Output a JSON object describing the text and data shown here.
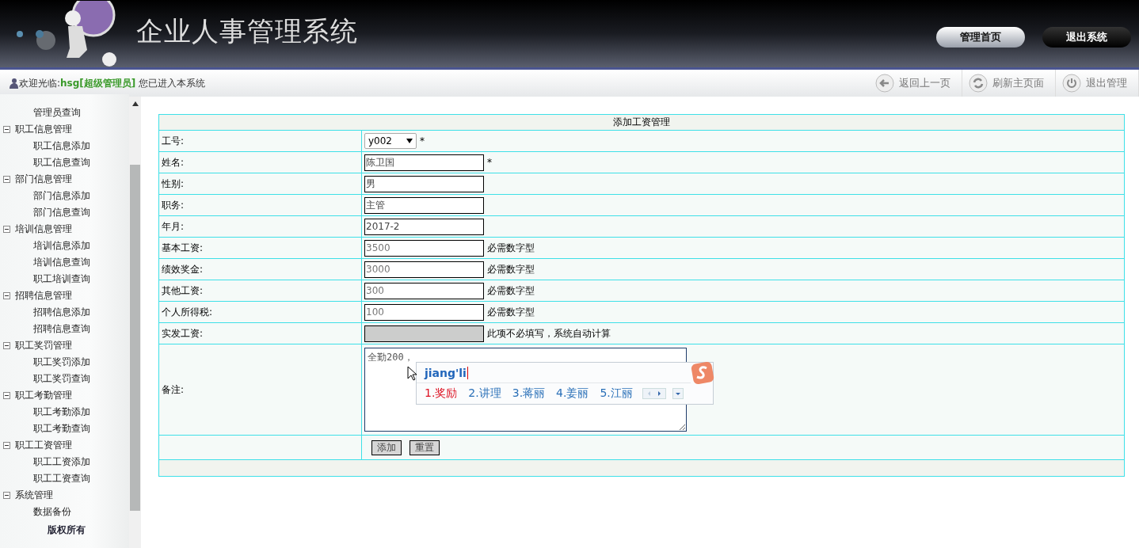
{
  "header": {
    "title": "企业人事管理系统",
    "buttons": [
      {
        "label": "管理首页",
        "kind": "light"
      },
      {
        "label": "退出系统",
        "kind": "dark"
      }
    ]
  },
  "welcome": {
    "prefix": "欢迎光临:",
    "user": "hsg[超级管理员]",
    "suffix": "您已进入本系统"
  },
  "toolbar": [
    {
      "label": "返回上一页",
      "kind": "back"
    },
    {
      "label": "刷新主页面",
      "kind": "refresh"
    },
    {
      "label": "退出管理",
      "kind": "power"
    }
  ],
  "sidebar": {
    "tree": [
      {
        "children": [
          {
            "label": "管理员查询"
          }
        ]
      },
      {
        "label": "职工信息管理",
        "expanded": true,
        "children": [
          {
            "label": "职工信息添加"
          },
          {
            "label": "职工信息查询"
          }
        ]
      },
      {
        "label": "部门信息管理",
        "expanded": true,
        "children": [
          {
            "label": "部门信息添加"
          },
          {
            "label": "部门信息查询"
          }
        ]
      },
      {
        "label": "培训信息管理",
        "expanded": true,
        "children": [
          {
            "label": "培训信息添加"
          },
          {
            "label": "培训信息查询"
          },
          {
            "label": "职工培训查询"
          }
        ]
      },
      {
        "label": "招聘信息管理",
        "expanded": true,
        "children": [
          {
            "label": "招聘信息添加"
          },
          {
            "label": "招聘信息查询"
          }
        ]
      },
      {
        "label": "职工奖罚管理",
        "expanded": true,
        "children": [
          {
            "label": "职工奖罚添加"
          },
          {
            "label": "职工奖罚查询"
          }
        ]
      },
      {
        "label": "职工考勤管理",
        "expanded": true,
        "children": [
          {
            "label": "职工考勤添加"
          },
          {
            "label": "职工考勤查询"
          }
        ]
      },
      {
        "label": "职工工资管理",
        "expanded": true,
        "children": [
          {
            "label": "职工工资添加"
          },
          {
            "label": "职工工资查询"
          }
        ]
      },
      {
        "label": "系统管理",
        "expanded": true,
        "children": [
          {
            "label": "数据备份"
          }
        ]
      }
    ],
    "footer": "版权所有"
  },
  "form": {
    "title": "添加工资管理",
    "rows": [
      {
        "kind": "select",
        "label": "工号:",
        "value": "y002",
        "mark": "*"
      },
      {
        "kind": "text",
        "label": "姓名:",
        "value": "陈卫国",
        "mark": "*"
      },
      {
        "kind": "text",
        "label": "性别:",
        "value": "男"
      },
      {
        "kind": "text",
        "label": "职务:",
        "value": "主管"
      },
      {
        "kind": "text",
        "label": "年月:",
        "value": "2017-2"
      },
      {
        "kind": "text",
        "label": "基本工资:",
        "value": "3500",
        "hint": "必需数字型"
      },
      {
        "kind": "text",
        "label": "绩效奖金:",
        "value": "3000",
        "hint": "必需数字型"
      },
      {
        "kind": "text",
        "label": "其他工资:",
        "value": "300",
        "hint": "必需数字型"
      },
      {
        "kind": "text",
        "label": "个人所得税:",
        "value": "100",
        "hint": "必需数字型"
      },
      {
        "kind": "disabled",
        "label": "实发工资:",
        "hint": "此项不必填写，系统自动计算"
      },
      {
        "kind": "textarea",
        "label": "备注:",
        "value": "全勤200，"
      }
    ],
    "buttons": [
      "添加",
      "重置"
    ]
  },
  "ime": {
    "composition": "jiang'li",
    "candidates": [
      {
        "text": "1.奖励",
        "selected": true
      },
      {
        "text": "2.讲理",
        "selected": false
      },
      {
        "text": "3.蒋丽",
        "selected": false
      },
      {
        "text": "4.姜丽",
        "selected": false
      },
      {
        "text": "5.江丽",
        "selected": false
      }
    ]
  }
}
